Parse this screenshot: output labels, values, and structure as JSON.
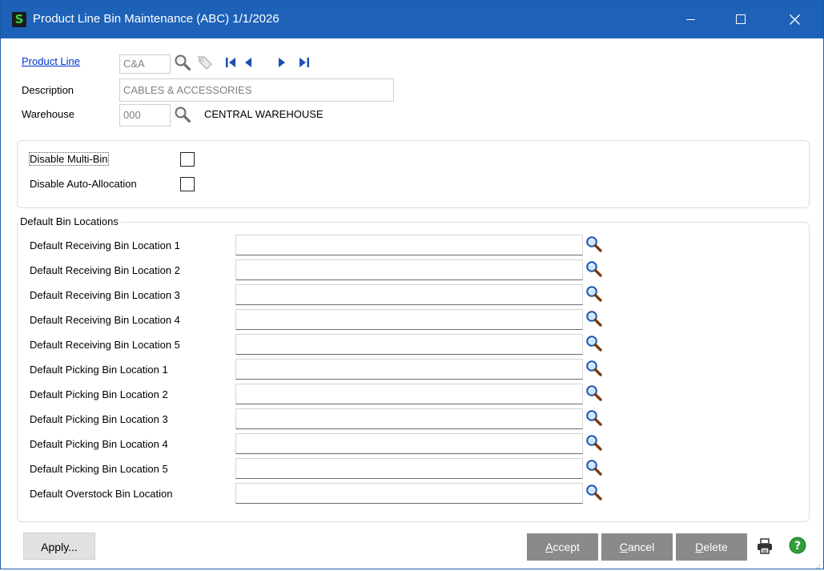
{
  "window": {
    "app_icon_letter": "S",
    "title": "Product Line Bin Maintenance (ABC) 1/1/2026"
  },
  "header": {
    "product_line_label": "Product Line",
    "product_line_value": "C&A",
    "description_label": "Description",
    "description_value": "CABLES & ACCESSORIES",
    "warehouse_label": "Warehouse",
    "warehouse_value": "000",
    "warehouse_name": "CENTRAL WAREHOUSE"
  },
  "options": {
    "disable_multi_bin_label": "Disable Multi-Bin",
    "disable_multi_bin_checked": false,
    "disable_auto_allocation_label": "Disable Auto-Allocation",
    "disable_auto_allocation_checked": false
  },
  "bins": {
    "group_title": "Default Bin Locations",
    "rows": [
      {
        "label": "Default Receiving Bin Location 1",
        "value": ""
      },
      {
        "label": "Default Receiving Bin Location 2",
        "value": ""
      },
      {
        "label": "Default Receiving Bin Location 3",
        "value": ""
      },
      {
        "label": "Default Receiving Bin Location 4",
        "value": ""
      },
      {
        "label": "Default Receiving Bin Location 5",
        "value": ""
      },
      {
        "label": "Default Picking Bin Location 1",
        "value": ""
      },
      {
        "label": "Default Picking Bin Location 2",
        "value": ""
      },
      {
        "label": "Default Picking Bin Location 3",
        "value": ""
      },
      {
        "label": "Default Picking Bin Location 4",
        "value": ""
      },
      {
        "label": "Default Picking Bin Location 5",
        "value": ""
      },
      {
        "label": "Default Overstock Bin Location",
        "value": ""
      }
    ]
  },
  "footer": {
    "apply": {
      "pre": "Apply",
      "key": "",
      "post": "..."
    },
    "accept": {
      "pre": "",
      "key": "A",
      "post": "ccept"
    },
    "cancel": {
      "pre": "",
      "key": "C",
      "post": "ancel"
    },
    "delete": {
      "pre": "",
      "key": "D",
      "post": "elete"
    }
  },
  "colors": {
    "titlebar": "#1d62b8",
    "dark_button": "#8a8a8a",
    "link": "#0033cc",
    "help_icon": "#2e9e3a"
  },
  "icons": [
    "search-icon",
    "tag-icon",
    "first-record-icon",
    "previous-record-icon",
    "next-record-icon",
    "last-record-icon",
    "printer-icon",
    "help-icon"
  ]
}
